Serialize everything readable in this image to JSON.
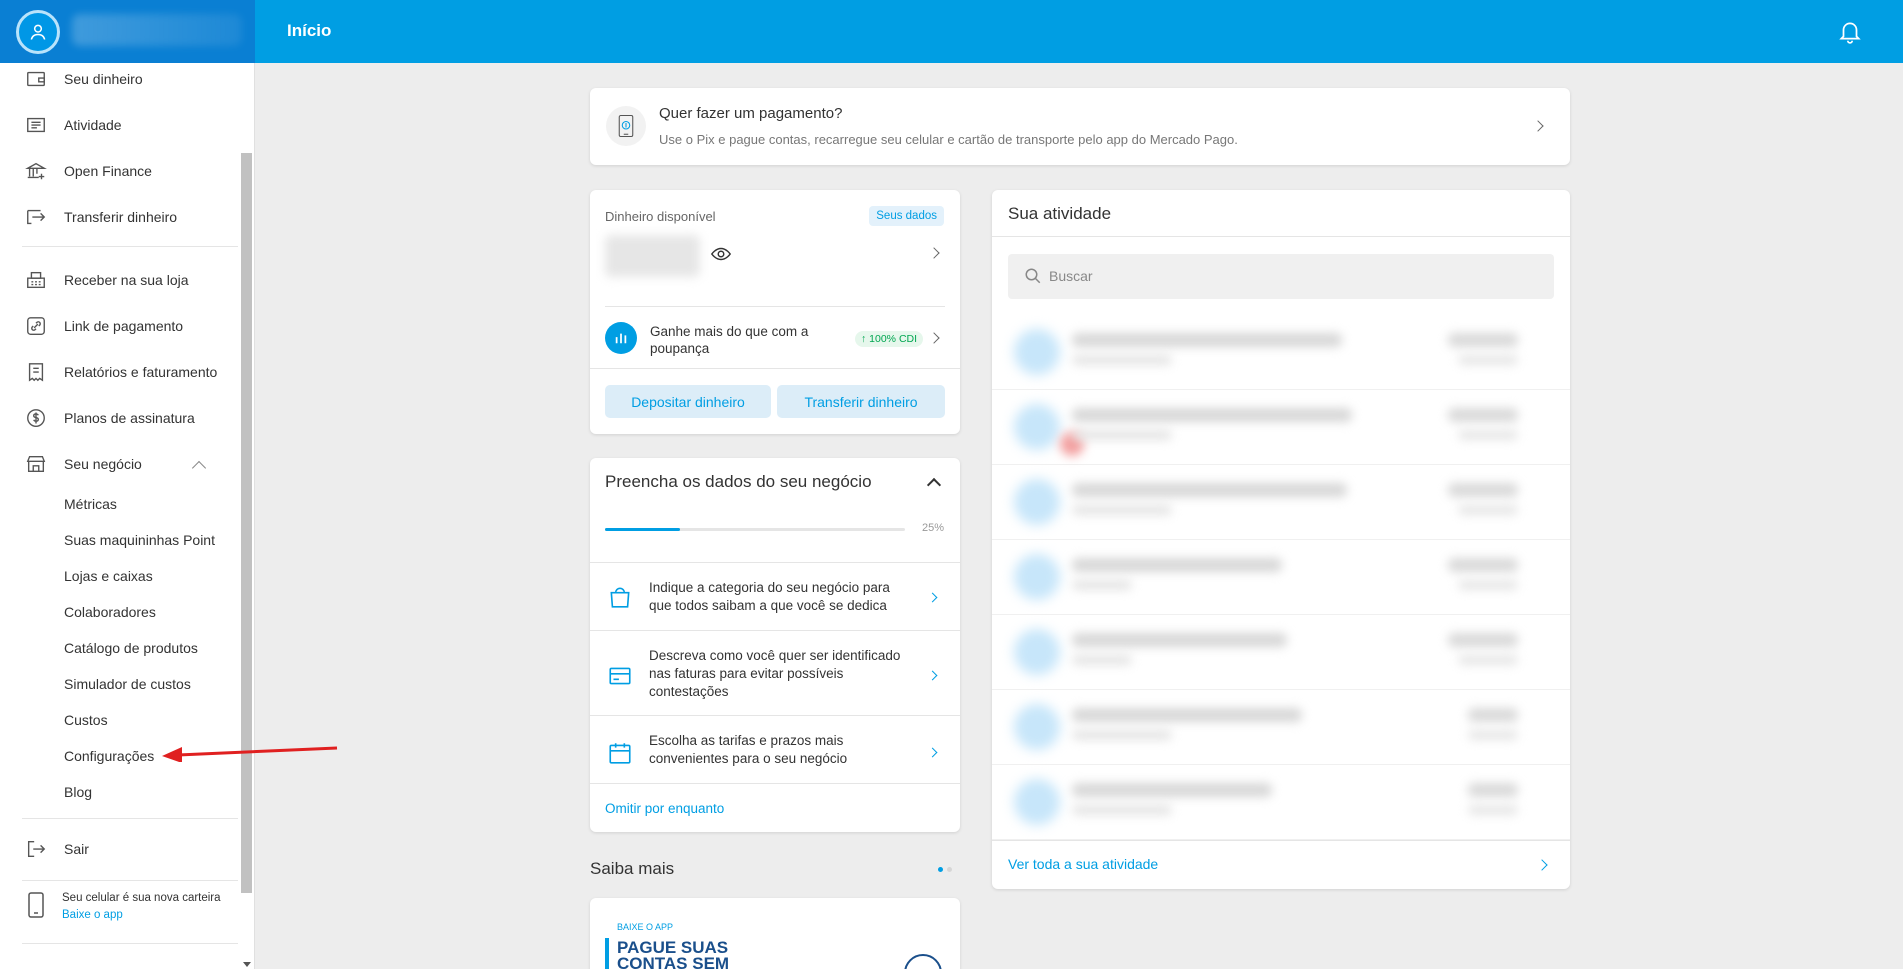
{
  "header": {
    "title": "Início"
  },
  "sidebar": {
    "items": [
      {
        "label": "Seu dinheiro",
        "icon": "wallet-icon"
      },
      {
        "label": "Atividade",
        "icon": "list-icon"
      },
      {
        "label": "Open Finance",
        "icon": "bank-icon"
      },
      {
        "label": "Transferir dinheiro",
        "icon": "transfer-icon"
      },
      {
        "label": "Receber na sua loja",
        "icon": "cash-register-icon"
      },
      {
        "label": "Link de pagamento",
        "icon": "link-icon"
      },
      {
        "label": "Relatórios e faturamento",
        "icon": "receipt-icon"
      },
      {
        "label": "Planos de assinatura",
        "icon": "dollar-cycle-icon"
      },
      {
        "label": "Seu negócio",
        "icon": "store-icon"
      }
    ],
    "subitems": [
      "Métricas",
      "Suas maquininhas Point",
      "Lojas e caixas",
      "Colaboradores",
      "Catálogo de produtos",
      "Simulador de custos",
      "Custos",
      "Configurações",
      "Blog"
    ],
    "logout": "Sair",
    "promo": {
      "text": "Seu celular é sua nova carteira",
      "link": "Baixe o app"
    }
  },
  "payment_card": {
    "title": "Quer fazer um pagamento?",
    "subtitle": "Use o Pix e pague contas, recarregue seu celular e cartão de transporte pelo app do Mercado Pago."
  },
  "money_card": {
    "label": "Dinheiro disponível",
    "badge": "Seus dados",
    "invest_text": "Ganhe mais do que com a poupança",
    "invest_badge": "↑ 100% CDI",
    "deposit_button": "Depositar dinheiro",
    "transfer_button": "Transferir dinheiro"
  },
  "business_card": {
    "title": "Preencha os dados do seu negócio",
    "progress": 0.25,
    "progress_label": "25%",
    "tasks": [
      "Indique a categoria do seu negócio para que todos saibam a que você se dedica",
      "Descreva como você quer ser identificado nas faturas para evitar possíveis contestações",
      "Escolha as tarifas e prazos mais convenientes para o seu negócio"
    ],
    "skip": "Omitir por enquanto"
  },
  "saiba_mais": {
    "title": "Saiba mais",
    "promo_tag": "BAIXE O APP",
    "promo_head": "PAGUE SUAS CONTAS SEM"
  },
  "activity": {
    "title": "Sua atividade",
    "search_placeholder": "Buscar",
    "footer_link": "Ver toda a sua atividade"
  },
  "colors": {
    "brand": "#009ee3",
    "sidebar_head": "#0a7fd3",
    "annotation": "#e02020"
  }
}
